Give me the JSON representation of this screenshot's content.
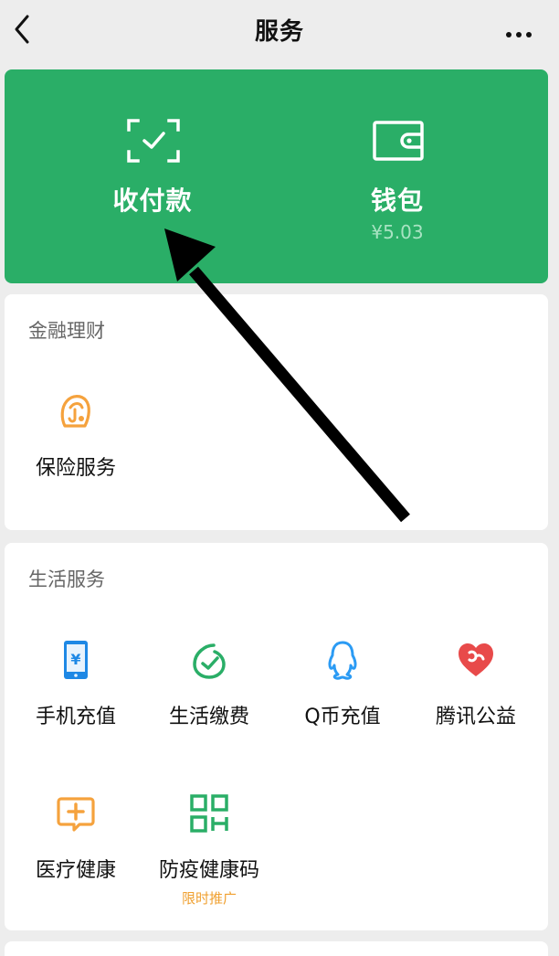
{
  "header": {
    "title": "服务",
    "back_icon": "chevron-left-icon",
    "more_icon": "more-dots-icon"
  },
  "pay_card": {
    "background": "#2aae67",
    "receive_pay": {
      "label": "收付款",
      "icon": "scan-check-icon"
    },
    "wallet": {
      "label": "钱包",
      "balance": "¥5.03",
      "icon": "wallet-icon"
    }
  },
  "finance": {
    "title": "金融理财",
    "items": [
      {
        "label": "保险服务",
        "icon": "insurance-icon",
        "color": "#f5a23d"
      }
    ]
  },
  "life": {
    "title": "生活服务",
    "items": [
      {
        "label": "手机充值",
        "icon": "phone-recharge-icon",
        "color": "#1e88e5"
      },
      {
        "label": "生活缴费",
        "icon": "utility-payment-icon",
        "color": "#2aae67"
      },
      {
        "label": "Q币充值",
        "icon": "qq-penguin-icon",
        "color": "#2b9bf4"
      },
      {
        "label": "腾讯公益",
        "icon": "charity-heart-icon",
        "color": "#e84a4a"
      },
      {
        "label": "医疗健康",
        "icon": "medical-icon",
        "color": "#f5a23d"
      },
      {
        "label": "防疫健康码",
        "icon": "qr-code-icon",
        "color": "#2aae67",
        "tag": "限时推广"
      }
    ]
  },
  "annotation": {
    "icon": "pointer-arrow-icon",
    "color": "#000000"
  }
}
